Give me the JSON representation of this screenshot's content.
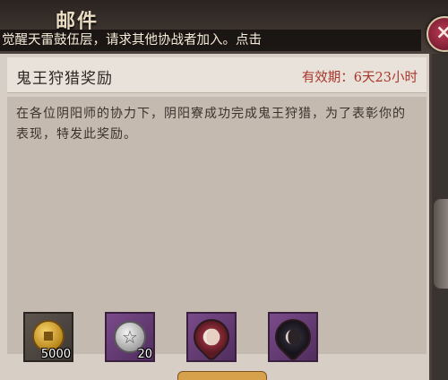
{
  "header": {
    "title": "邮件"
  },
  "banner": {
    "text": "觉醒天雷鼓伍层，请求其他协战者加入。点击"
  },
  "close": {
    "glyph": "×",
    "icon": "close-icon"
  },
  "mail": {
    "title": "鬼王狩猎奖励",
    "validity": "有效期：6天23小时",
    "body": "在各位阴阳师的协力下，阴阳寮成功完成鬼王狩猎，为了表彰你的表现，特发此奖励。"
  },
  "rewards": [
    {
      "icon": "gold-coin-icon",
      "count": "5000"
    },
    {
      "icon": "silver-star-coin-icon",
      "glyph": "☆",
      "count": "20"
    },
    {
      "icon": "shikigami-portrait-icon",
      "count": ""
    },
    {
      "icon": "shikigami-portrait-icon",
      "count": ""
    }
  ],
  "colors": {
    "validity": "#a8362a",
    "purple_frame": "#7c4c8c",
    "close_button": "#b93a52"
  }
}
